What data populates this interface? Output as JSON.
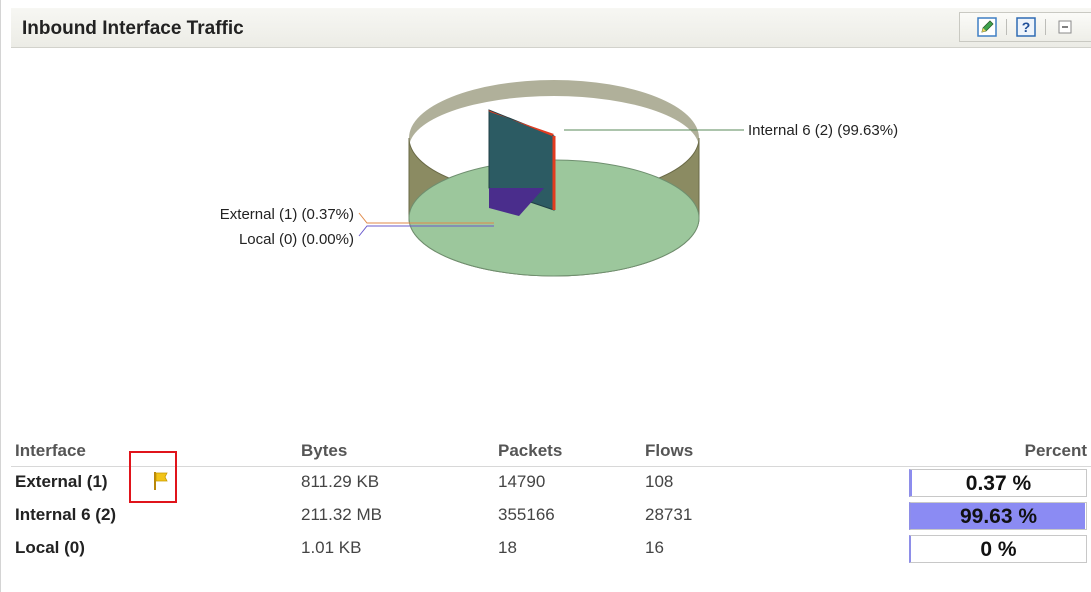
{
  "panel": {
    "title": "Inbound Interface Traffic",
    "tools": [
      "edit-icon",
      "help-icon",
      "collapse-icon"
    ]
  },
  "chart_data": {
    "type": "pie",
    "categories": [
      "Internal 6 (2)",
      "External (1)",
      "Local (0)"
    ],
    "values": [
      99.63,
      0.37,
      0.0
    ],
    "labels": [
      "Internal 6 (2) (99.63%)",
      "External (1) (0.37%)",
      "Local (0) (0.00%)"
    ],
    "colors": [
      "#9cc79c",
      "#e23b1f",
      "#4a2d8c"
    ]
  },
  "table": {
    "headers": {
      "interface": "Interface",
      "bytes": "Bytes",
      "packets": "Packets",
      "flows": "Flows",
      "percent": "Percent"
    },
    "rows": [
      {
        "interface": "External (1)",
        "bytes": "811.29 KB",
        "packets": "14790",
        "flows": "108",
        "percent_label": "0.37 %",
        "percent_value": 0.37,
        "flagged": true
      },
      {
        "interface": "Internal 6 (2)",
        "bytes": "211.32 MB",
        "packets": "355166",
        "flows": "28731",
        "percent_label": "99.63 %",
        "percent_value": 99.63,
        "flagged": false
      },
      {
        "interface": "Local (0)",
        "bytes": "1.01 KB",
        "packets": "18",
        "flows": "16",
        "percent_label": "0 %",
        "percent_value": 0,
        "flagged": false
      }
    ]
  },
  "colors": {
    "percent_bar": "#8b8bf3",
    "highlight": "#e0141b",
    "flag": "#f2c418"
  }
}
